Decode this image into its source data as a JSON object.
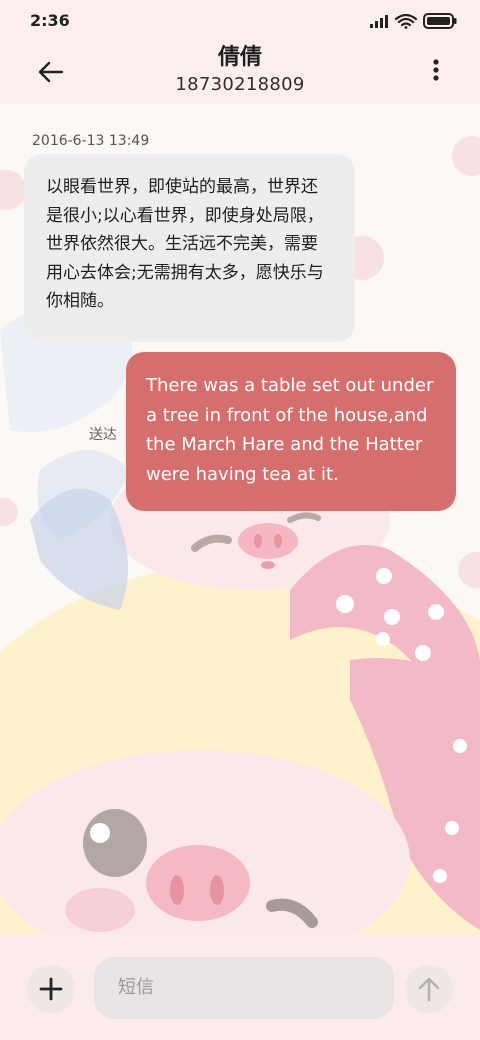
{
  "status_bar": {
    "time": "2:36",
    "icons": [
      "signal-icon",
      "wifi-icon",
      "battery-icon"
    ]
  },
  "header": {
    "contact_name": "倩倩",
    "phone": "18730218809",
    "back_icon": "back-arrow-icon",
    "more_icon": "more-vertical-icon"
  },
  "conversation": {
    "timestamp": "2016-6-13 13:49",
    "incoming_message": "以眼看世界，即使站的最高，世界还是很小;以心看世界，即使身处局限，世界依然很大。生活远不完美，需要用心去体会;无需拥有太多，愿快乐与你相随。",
    "outgoing_message": "There was a table set out under a tree in front of the house,and the March Hare and the Hatter were having tea at it.",
    "outgoing_status": "送达"
  },
  "compose": {
    "placeholder": "短信",
    "add_icon": "plus-icon",
    "send_icon": "send-arrow-icon"
  },
  "colors": {
    "header_bg": "#fdeff0",
    "incoming_bubble": "#ececec",
    "outgoing_bubble": "#d56f6d",
    "bottom_bar": "#fcebeb"
  }
}
